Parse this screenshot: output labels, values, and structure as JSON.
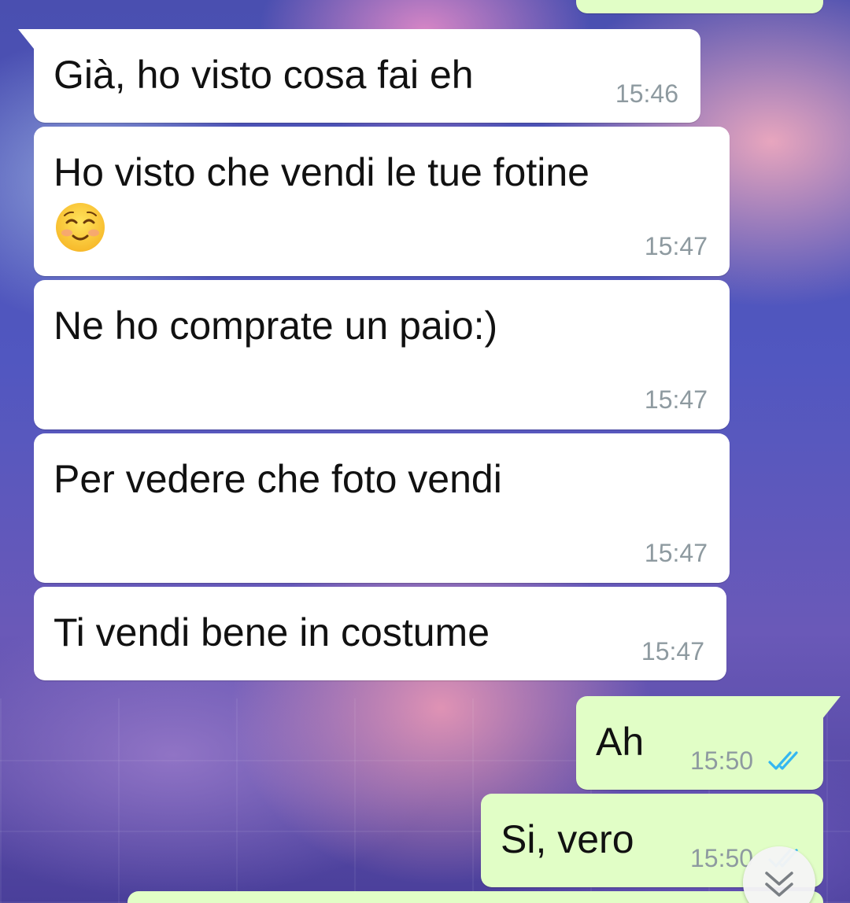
{
  "messages": [
    {
      "text": "Già, ho visto cosa fai eh",
      "time": "15:46",
      "direction": "incoming"
    },
    {
      "text": "Ho visto che vendi le tue fotine",
      "emoji": "smiling-face-with-smiling-eyes",
      "time": "15:47",
      "direction": "incoming"
    },
    {
      "text": "Ne ho comprate un paio:)",
      "time": "15:47",
      "direction": "incoming"
    },
    {
      "text": "Per vedere che foto vendi",
      "time": "15:47",
      "direction": "incoming"
    },
    {
      "text": "Ti vendi bene in costume",
      "time": "15:47",
      "direction": "incoming"
    },
    {
      "text": "Ah",
      "time": "15:50",
      "direction": "outgoing",
      "status": "read"
    },
    {
      "text": "Si, vero",
      "time": "15:50",
      "direction": "outgoing",
      "status": "read"
    }
  ],
  "icons": {
    "read_ticks": "double-check-icon",
    "scroll_down": "chevron-double-down-icon",
    "emoji": "smiling-face-emoji-icon"
  },
  "colors": {
    "incoming_bubble": "#ffffff",
    "outgoing_bubble": "#e1fec6",
    "read_tick": "#34b7f1",
    "timestamp": "#8e9aa0"
  }
}
